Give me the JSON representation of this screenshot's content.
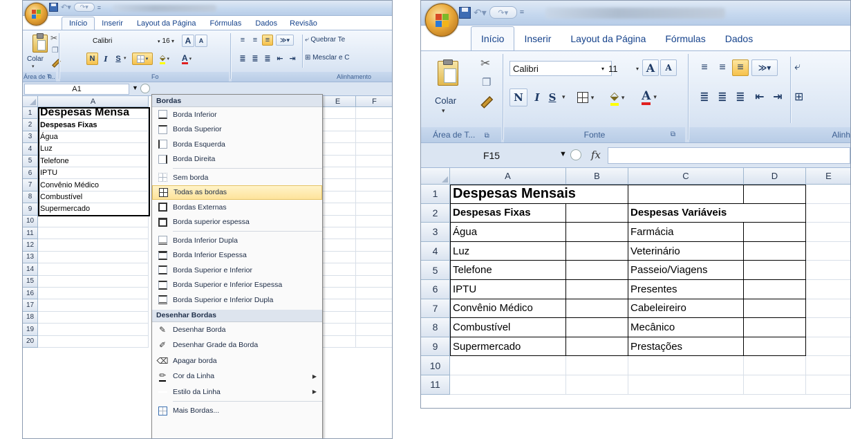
{
  "left": {
    "tabs": [
      "Início",
      "Inserir",
      "Layout da Página",
      "Fórmulas",
      "Dados",
      "Revisão"
    ],
    "ribbon": {
      "paste_label": "Colar",
      "font_name": "Calibri",
      "font_size": "16",
      "clipboard_group": "Área de T...",
      "font_group_partial": "Fo",
      "align_group": "Alinhamento",
      "wrap_text": "Quebrar Te",
      "merge": "Mesclar e C",
      "bold": "N",
      "italic": "I",
      "underline": "S",
      "grow_font": "A",
      "shrink_font": "A"
    },
    "name_box": "A1",
    "columns": [
      "A",
      "E",
      "F"
    ],
    "rows": [
      "1",
      "2",
      "3",
      "4",
      "5",
      "6",
      "7",
      "8",
      "9",
      "10",
      "11",
      "12",
      "13",
      "14",
      "15",
      "16",
      "17",
      "18",
      "19",
      "20"
    ],
    "cells": [
      {
        "row": 1,
        "text": "Despesas Mensa",
        "style": "title"
      },
      {
        "row": 2,
        "text": "Despesas Fixas",
        "style": "bold"
      },
      {
        "row": 3,
        "text": "Água",
        "style": ""
      },
      {
        "row": 4,
        "text": "Luz",
        "style": ""
      },
      {
        "row": 5,
        "text": "Telefone",
        "style": ""
      },
      {
        "row": 6,
        "text": "IPTU",
        "style": ""
      },
      {
        "row": 7,
        "text": "Convênio Médico",
        "style": ""
      },
      {
        "row": 8,
        "text": "Combustível",
        "style": ""
      },
      {
        "row": 9,
        "text": "Supermercado",
        "style": ""
      }
    ],
    "menu": {
      "header": "Bordas",
      "items": [
        {
          "label": "Borda Inferior",
          "icon": "border-bottom-icon"
        },
        {
          "label": "Borda Superior",
          "icon": "border-top-icon"
        },
        {
          "label": "Borda Esquerda",
          "icon": "border-left-icon"
        },
        {
          "label": "Borda Direita",
          "icon": "border-right-icon"
        },
        {
          "label": "Sem borda",
          "icon": "no-border-icon"
        },
        {
          "label": "Todas as bordas",
          "icon": "all-borders-icon",
          "highlight": true
        },
        {
          "label": "Bordas Externas",
          "icon": "outside-borders-icon"
        },
        {
          "label": "Borda superior espessa",
          "icon": "thick-box-border-icon"
        },
        {
          "label": "Borda Inferior Dupla",
          "icon": "double-bottom-border-icon"
        },
        {
          "label": "Borda Inferior Espessa",
          "icon": "thick-bottom-border-icon"
        },
        {
          "label": "Borda Superior e Inferior",
          "icon": "top-bottom-border-icon"
        },
        {
          "label": "Borda Superior e Inferior Espessa",
          "icon": "top-thick-bottom-border-icon"
        },
        {
          "label": "Borda Superior e Inferior Dupla",
          "icon": "top-double-bottom-border-icon"
        }
      ],
      "draw_header": "Desenhar Bordas",
      "draw_items": [
        {
          "label": "Desenhar Borda",
          "icon": "draw-border-icon"
        },
        {
          "label": "Desenhar Grade da Borda",
          "icon": "draw-border-grid-icon"
        },
        {
          "label": "Apagar borda",
          "icon": "eraser-icon"
        },
        {
          "label": "Cor da Linha",
          "icon": "line-color-icon",
          "submenu": true
        },
        {
          "label": "Estilo da Linha",
          "icon": "line-style-icon",
          "submenu": true
        },
        {
          "label": "Mais Bordas...",
          "icon": "more-borders-icon"
        }
      ]
    }
  },
  "right": {
    "tabs": [
      "Início",
      "Inserir",
      "Layout da Página",
      "Fórmulas",
      "Dados"
    ],
    "ribbon": {
      "paste_label": "Colar",
      "font_name": "Calibri",
      "font_size": "11",
      "clipboard_group": "Área de T...",
      "font_group": "Fonte",
      "align_group_partial": "Alinh",
      "bold": "N",
      "italic": "I",
      "underline": "S",
      "grow_font": "A",
      "shrink_font": "A"
    },
    "name_box": "F15",
    "fx": "fx",
    "columns": [
      "A",
      "B",
      "C",
      "D",
      "E"
    ],
    "rows": [
      "1",
      "2",
      "3",
      "4",
      "5",
      "6",
      "7",
      "8",
      "9",
      "10",
      "11"
    ],
    "title": "Despesas Mensais",
    "header_fixed": "Despesas Fixas",
    "header_variable": "Despesas Variáveis",
    "fixed": [
      "Água",
      "Luz",
      "Telefone",
      "IPTU",
      "Convênio Médico",
      "Combustível",
      "Supermercado"
    ],
    "variable": [
      "Farmácia",
      "Veterinário",
      "Passeio/Viagens",
      "Presentes",
      "Cabeleireiro",
      "Mecânico",
      "Prestações"
    ]
  }
}
